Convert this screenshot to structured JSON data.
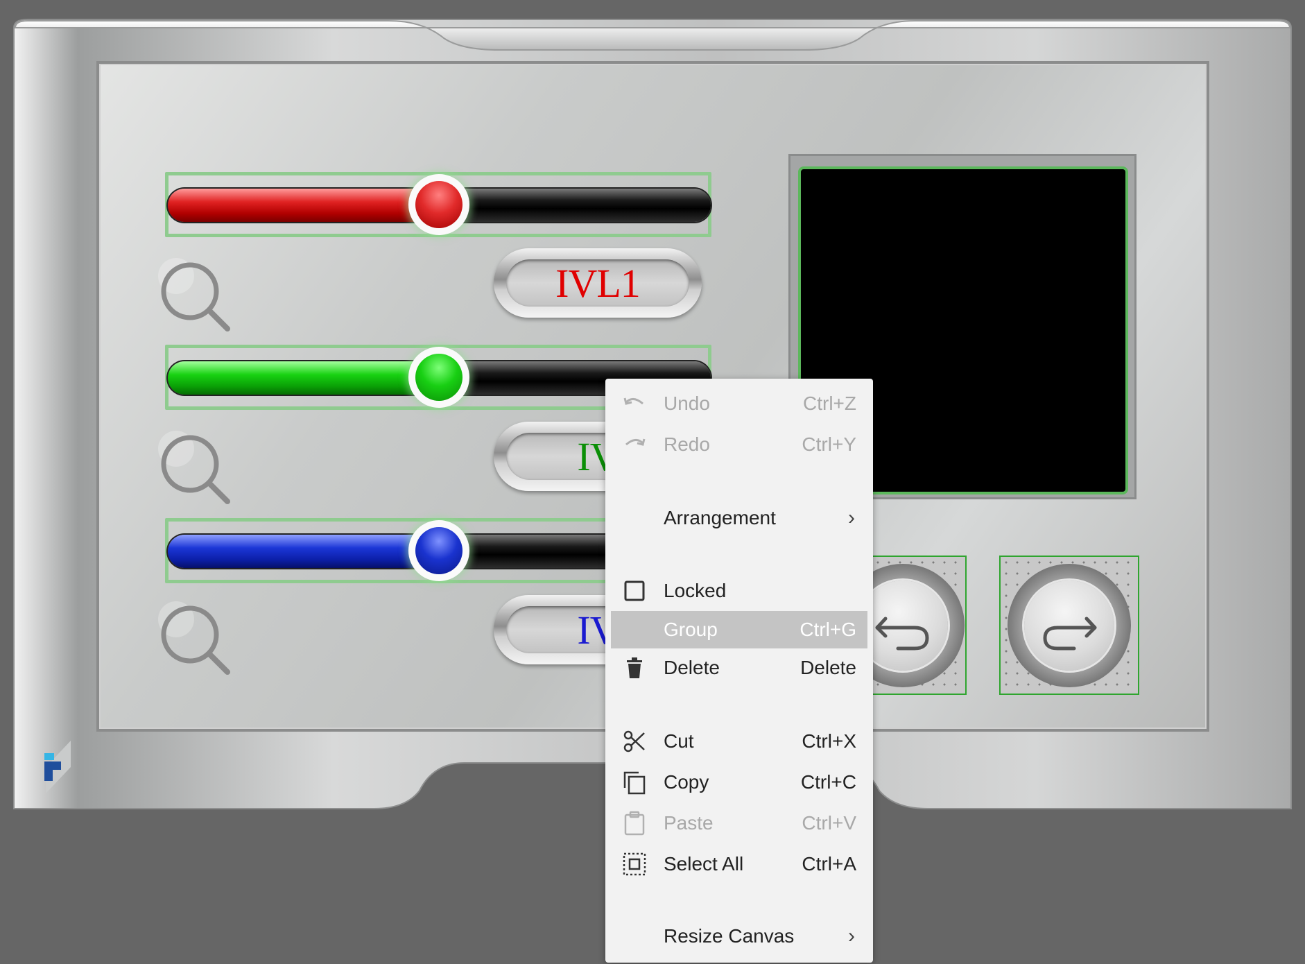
{
  "displays": [
    {
      "text": "IVL1",
      "color": "#e00000"
    },
    {
      "text": "IV",
      "color": "#0a8f06"
    },
    {
      "text": "IV",
      "color": "#1a1ad0"
    }
  ],
  "sliders": [
    {
      "name": "red",
      "value": 0.5
    },
    {
      "name": "green",
      "value": 0.5
    },
    {
      "name": "blue",
      "value": 0.5
    }
  ],
  "colors": {
    "selection_outline": "#8fcb8f",
    "screen_border": "#5cb85c",
    "menu_bg": "#f2f2f2",
    "menu_highlight": "#c4c4c4"
  },
  "context_menu": {
    "undo": {
      "label": "Undo",
      "shortcut": "Ctrl+Z",
      "icon": "undo-icon"
    },
    "redo": {
      "label": "Redo",
      "shortcut": "Ctrl+Y",
      "icon": "redo-icon"
    },
    "arrangement": {
      "label": "Arrangement",
      "icon": "chevron-right-icon"
    },
    "locked": {
      "label": "Locked",
      "icon": "checkbox-icon"
    },
    "group": {
      "label": "Group",
      "shortcut": "Ctrl+G"
    },
    "delete": {
      "label": "Delete",
      "shortcut": "Delete",
      "icon": "trash-icon"
    },
    "cut": {
      "label": "Cut",
      "shortcut": "Ctrl+X",
      "icon": "scissors-icon"
    },
    "copy": {
      "label": "Copy",
      "shortcut": "Ctrl+C",
      "icon": "copy-icon"
    },
    "paste": {
      "label": "Paste",
      "shortcut": "Ctrl+V",
      "icon": "clipboard-icon"
    },
    "select_all": {
      "label": "Select All",
      "shortcut": "Ctrl+A",
      "icon": "select-all-icon"
    },
    "resize_canvas": {
      "label": "Resize Canvas",
      "icon": "chevron-right-icon"
    }
  }
}
